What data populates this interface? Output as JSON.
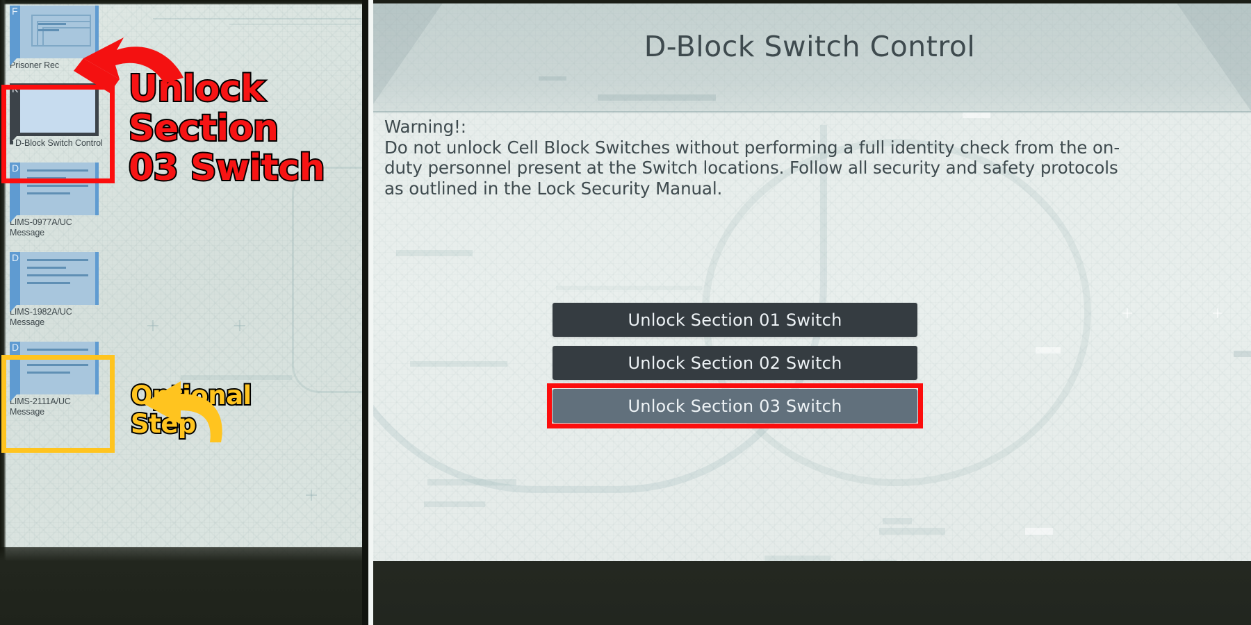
{
  "window": {
    "left_panel_name": "file-browser",
    "right_panel_name": "terminal-screen"
  },
  "file_browser": {
    "items": [
      {
        "tag": "F",
        "icon": "documents-stack-icon",
        "label": "Prisoner Rec",
        "selected": false,
        "bullet": false
      },
      {
        "tag": "K",
        "icon": "blank-screen-icon",
        "label": "D-Block Switch Control",
        "selected": true,
        "bullet": true
      },
      {
        "tag": "D",
        "icon": "message-lines-icon",
        "label": "LIMS-0977A/UC Message",
        "selected": false,
        "bullet": false
      },
      {
        "tag": "D",
        "icon": "message-lines-icon",
        "label": "LIMS-1982A/UC Message",
        "selected": false,
        "bullet": false
      },
      {
        "tag": "D",
        "icon": "message-lines-icon",
        "label": "LIMS-2111A/UC Message",
        "selected": false,
        "bullet": false
      }
    ]
  },
  "annotations": {
    "red_callout_text": "Unlock\nSection\n03 Switch",
    "red_arrow_icon": "curved-arrow-icon",
    "red_color": "#f71414",
    "yellow_callout_text": "Optional\nStep",
    "yellow_arrow_icon": "curved-arrow-icon",
    "yellow_color": "#ffc41f",
    "red_box_color": "#fc0d0d",
    "yellow_box_color": "#ffc41f"
  },
  "terminal": {
    "title": "D-Block Switch Control",
    "warning_label": "Warning!:",
    "warning_lines": [
      "Do not unlock Cell Block Switches without performing a full identity check from the on-",
      "duty personnel present at the Switch locations. Follow all security and safety protocols",
      "as outlined in the Lock Security Manual."
    ],
    "buttons": [
      {
        "label": "Unlock Section 01 Switch",
        "state": "normal"
      },
      {
        "label": "Unlock Section 02 Switch",
        "state": "normal"
      },
      {
        "label": "Unlock Section 03 Switch",
        "state": "highlighted"
      }
    ],
    "button_color": "#353c41",
    "button_active_color": "#61707c",
    "text_color": "#3e4a4e"
  }
}
